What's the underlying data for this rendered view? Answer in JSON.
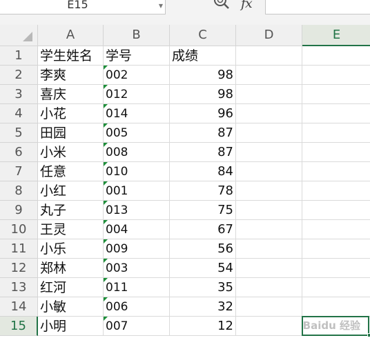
{
  "formula_bar": {
    "name_box": "E15",
    "fx_label": "fx",
    "formula": ""
  },
  "columns": [
    "A",
    "B",
    "C",
    "D",
    "E"
  ],
  "selected_column": "E",
  "selected_row": "15",
  "rows": [
    {
      "num": "1",
      "a": "学生姓名",
      "b": "学号",
      "c": "成绩"
    },
    {
      "num": "2",
      "a": "李爽",
      "b": "002",
      "c": "98"
    },
    {
      "num": "3",
      "a": "喜庆",
      "b": "012",
      "c": "98"
    },
    {
      "num": "4",
      "a": "小花",
      "b": "014",
      "c": "96"
    },
    {
      "num": "5",
      "a": "田园",
      "b": "005",
      "c": "87"
    },
    {
      "num": "6",
      "a": "小米",
      "b": "008",
      "c": "87"
    },
    {
      "num": "7",
      "a": "任意",
      "b": "010",
      "c": "84"
    },
    {
      "num": "8",
      "a": "小红",
      "b": "001",
      "c": "78"
    },
    {
      "num": "9",
      "a": "丸子",
      "b": "013",
      "c": "75"
    },
    {
      "num": "10",
      "a": "王灵",
      "b": "004",
      "c": "67"
    },
    {
      "num": "11",
      "a": "小乐",
      "b": "009",
      "c": "56"
    },
    {
      "num": "12",
      "a": "郑林",
      "b": "003",
      "c": "54"
    },
    {
      "num": "13",
      "a": "红河",
      "b": "011",
      "c": "35"
    },
    {
      "num": "14",
      "a": "小敏",
      "b": "006",
      "c": "32"
    },
    {
      "num": "15",
      "a": "小明",
      "b": "007",
      "c": "12"
    }
  ],
  "colors": {
    "accent": "#217346",
    "text_number_marker": "#1e8f3a"
  },
  "watermark": "Baidu 经验"
}
